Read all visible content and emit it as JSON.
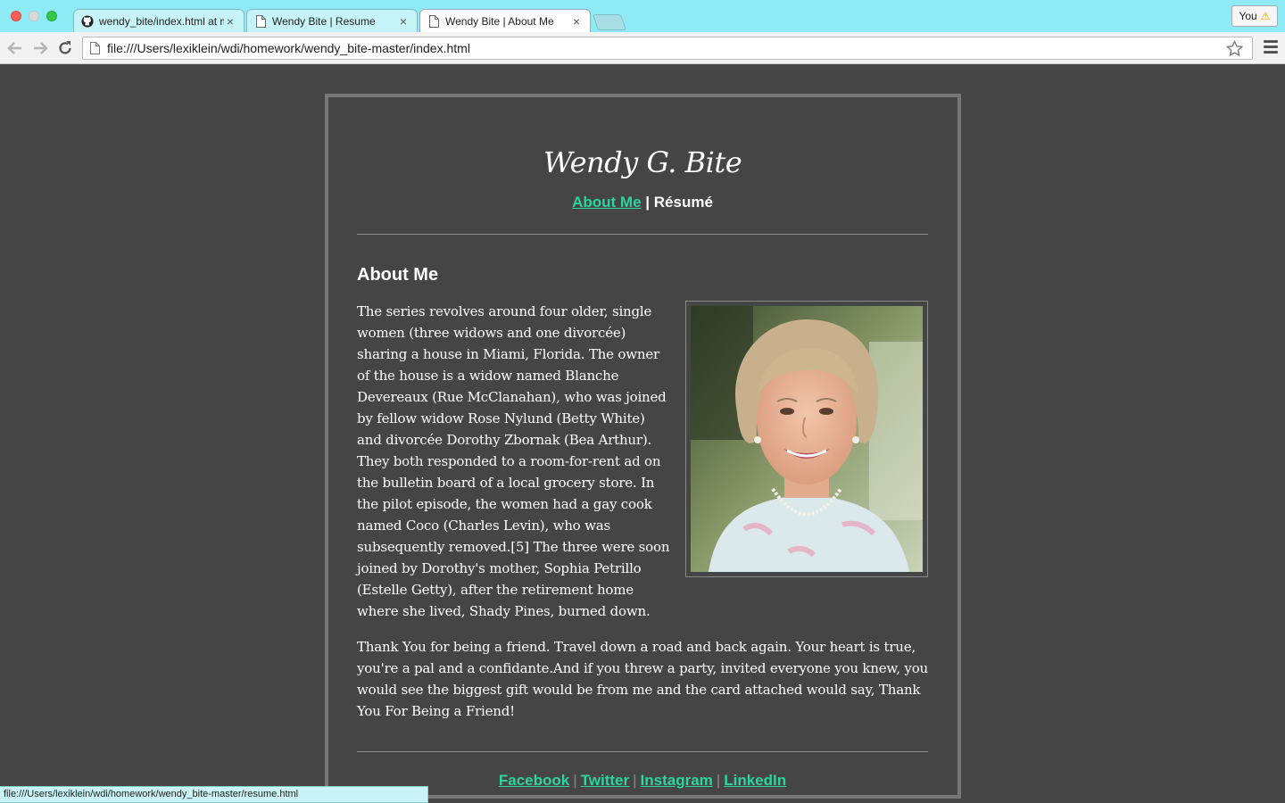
{
  "browser": {
    "tabs": [
      {
        "title": "wendy_bite/index.html at m",
        "icon": "github-icon",
        "active": false
      },
      {
        "title": "Wendy Bite | Resume",
        "icon": "page-icon",
        "active": false
      },
      {
        "title": "Wendy Bite | About Me",
        "icon": "page-icon",
        "active": true
      }
    ],
    "close_glyph": "×",
    "profile_label": "You",
    "url": "file:///Users/lexiklein/wdi/homework/wendy_bite-master/index.html",
    "status_url": "file:///Users/lexiklein/wdi/homework/wendy_bite-master/resume.html"
  },
  "page": {
    "site_title": "Wendy G. Bite",
    "nav": {
      "about_label": "About Me",
      "separator": "|",
      "resume_label": "Résumé"
    },
    "section_heading": "About Me",
    "paragraph1": "The series revolves around four older, single women (three widows and one divorcée) sharing a house in Miami, Florida. The owner of the house is a widow named Blanche Devereaux (Rue McClanahan), who was joined by fellow widow Rose Nylund (Betty White) and divorcée Dorothy Zbornak (Bea Arthur). They both responded to a room-for-rent ad on the bulletin board of a local grocery store. In the pilot episode, the women had a gay cook named Coco (Charles Levin), who was subsequently removed.[5] The three were soon joined by Dorothy's mother, Sophia Petrillo (Estelle Getty), after the retirement home where she lived, Shady Pines, burned down.",
    "paragraph2": "Thank You for being a friend. Travel down a road and back again. Your heart is true, you're a pal and a confidante.And if you threw a party, invited everyone you knew, you would see the biggest gift would be from me and the card attached would say, Thank You For Being a Friend!",
    "footer": {
      "links": [
        "Facebook",
        "Twitter",
        "Instagram",
        "LinkedIn"
      ],
      "separator": "|"
    }
  },
  "colors": {
    "page_bg": "#454545",
    "link": "#2ed3a0",
    "tabbar": "#8eeaf4"
  }
}
